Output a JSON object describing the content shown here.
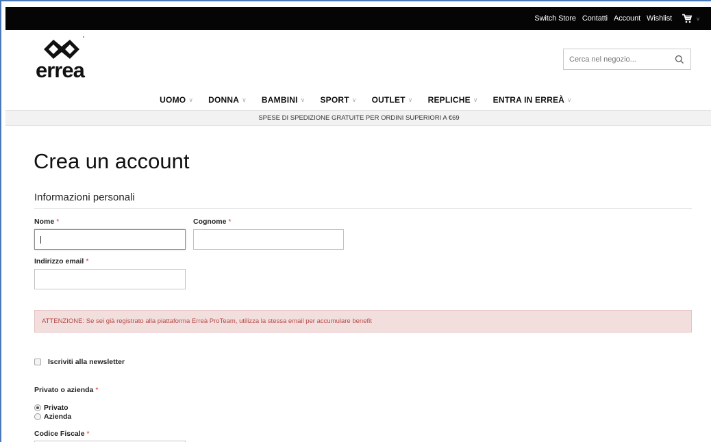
{
  "topbar": {
    "links": [
      "Switch Store",
      "Contatti",
      "Account",
      "Wishlist"
    ],
    "cart_icon": "cart-icon"
  },
  "logo": {
    "text": "errea"
  },
  "search": {
    "placeholder": "Cerca nel negozio..."
  },
  "nav": {
    "items": [
      {
        "label": "UOMO"
      },
      {
        "label": "DONNA"
      },
      {
        "label": "BAMBINI"
      },
      {
        "label": "SPORT"
      },
      {
        "label": "OUTLET"
      },
      {
        "label": "REPLICHE"
      },
      {
        "label": "ENTRA IN ERREÀ"
      }
    ]
  },
  "promo": {
    "text": "SPESE DI SPEDIZIONE GRATUITE PER ORDINI SUPERIORI A €69"
  },
  "page": {
    "title": "Crea un account",
    "section_title": "Informazioni personali"
  },
  "form": {
    "required_mark": "*",
    "nome_label": "Nome",
    "nome_value": "",
    "cognome_label": "Cognome",
    "cognome_value": "",
    "email_label": "Indirizzo email",
    "email_value": "",
    "notice": "ATTENZIONE: Se sei già registrato alla piattaforma Erreà ProTeam, utilizza la stessa email per accumulare benefit",
    "newsletter_label": "Iscriviti alla newsletter",
    "newsletter_checked": false,
    "tipo_label": "Privato o azienda",
    "tipo_options": [
      "Privato",
      "Azienda"
    ],
    "tipo_selected": "Privato",
    "codice_fiscale_label": "Codice Fiscale"
  },
  "colors": {
    "topbar_bg": "#050505",
    "required": "#e02b27",
    "notice_bg": "#f3dede",
    "notice_text": "#b34a45"
  }
}
